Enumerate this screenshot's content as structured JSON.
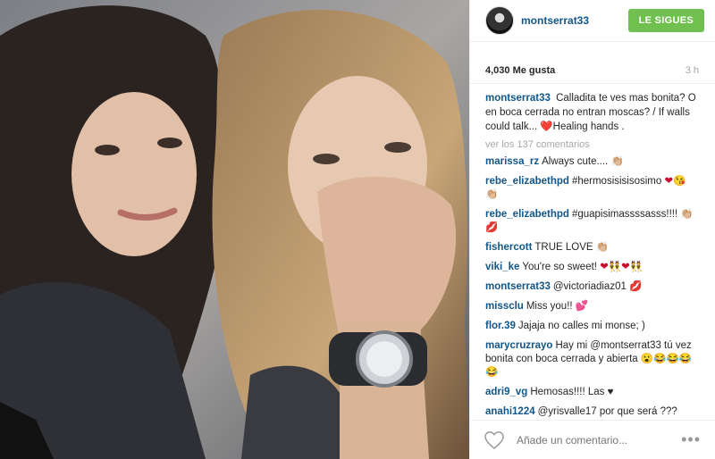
{
  "header": {
    "username": "montserrat33",
    "follow_label": "LE SIGUES"
  },
  "stats": {
    "likes": "4,030 Me gusta",
    "time": "3 h"
  },
  "caption": {
    "user": "montserrat33",
    "text": "Calladita te ves mas bonita? O en boca cerrada no entran moscas? / If walls could talk... ❤️Healing hands ."
  },
  "view_more": "ver los 137 comentarios",
  "comments": [
    {
      "user": "marissa_rz",
      "text": "Always cute....",
      "emoji": "👏🏼"
    },
    {
      "user": "rebe_elizabethpd",
      "text": "#hermosisisisosimo",
      "emoji": "❤😘👏🏼"
    },
    {
      "user": "rebe_elizabethpd",
      "text": "#guapisimassssasss!!!!",
      "emoji": "👏🏼💋"
    },
    {
      "user": "fishercott",
      "text": "TRUE LOVE",
      "emoji": "👏🏼"
    },
    {
      "user": "viki_ke",
      "text": "You're so sweet!",
      "emoji": "❤👯❤👯"
    },
    {
      "user": "montserrat33",
      "text": "@victoriadiaz01",
      "emoji": "💋"
    },
    {
      "user": "missclu",
      "text": "Miss you!!",
      "emoji": "💕"
    },
    {
      "user": "flor.39",
      "text": "Jajaja no calles mi monse; )",
      "emoji": ""
    },
    {
      "user": "marycruzrayo",
      "text": "Hay mi @montserrat33 tú vez bonita con boca cerrada y abierta",
      "emoji": "😮😂😂😂😂"
    },
    {
      "user": "adri9_vg",
      "text": "Hemosas!!!! Las ♥",
      "emoji": ""
    },
    {
      "user": "anahi1224",
      "text": "@yrisvalle17 por que será ???",
      "emoji": ""
    }
  ],
  "footer": {
    "placeholder": "Añade un comentario...",
    "more": "•••"
  }
}
